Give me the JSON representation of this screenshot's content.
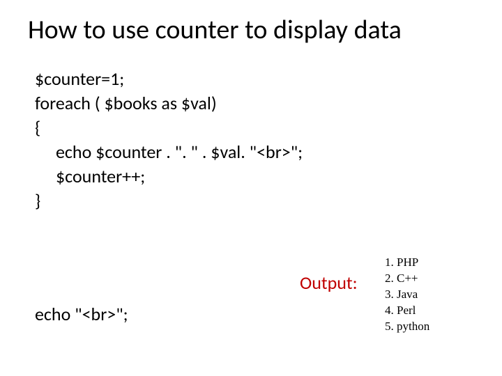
{
  "title": "How to use counter to display data",
  "code": {
    "l1": "$counter=1;",
    "l2": "foreach ( $books as $val)",
    "l3": "{",
    "l4": "echo $counter . \". \" . $val. \"<br>\";",
    "l5": "$counter++;",
    "l6": "}",
    "final": "echo \"<br>\";"
  },
  "output_label": "Output:",
  "output_items": [
    {
      "num": "1.",
      "text": "PHP"
    },
    {
      "num": "2.",
      "text": "C++"
    },
    {
      "num": "3.",
      "text": "Java"
    },
    {
      "num": "4.",
      "text": "Perl"
    },
    {
      "num": "5.",
      "text": "python"
    }
  ]
}
